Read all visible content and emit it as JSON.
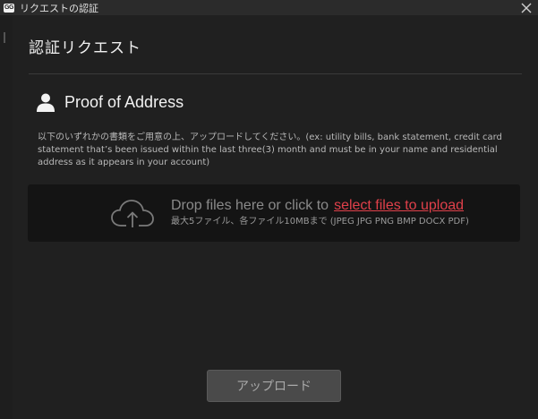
{
  "window": {
    "logo_text": "GG",
    "title": "リクエストの認証"
  },
  "panel": {
    "title": "認証リクエスト"
  },
  "section": {
    "title": "Proof of Address",
    "instructions": "以下のいずれかの書類をご用意の上、アップロードしてください。(ex: utility bills, bank statement, credit card statement that’s been issued within the last three(3) month and must be in your name and residential address as it appears in your account)"
  },
  "dropzone": {
    "prompt": "Drop files here or click to",
    "link_text": "select files to upload",
    "limits": "最大5ファイル、各ファイル10MBまで (JPEG JPG PNG BMP DOCX PDF)"
  },
  "actions": {
    "upload_label": "アップロード"
  },
  "colors": {
    "accent_link": "#e0404a",
    "background": "#202020",
    "dropzone": "#141414",
    "button": "#4a4a4a"
  },
  "icons": {
    "logo": "app-logo",
    "close": "close-icon",
    "section": "person-icon",
    "dropzone": "cloud-upload-icon"
  }
}
